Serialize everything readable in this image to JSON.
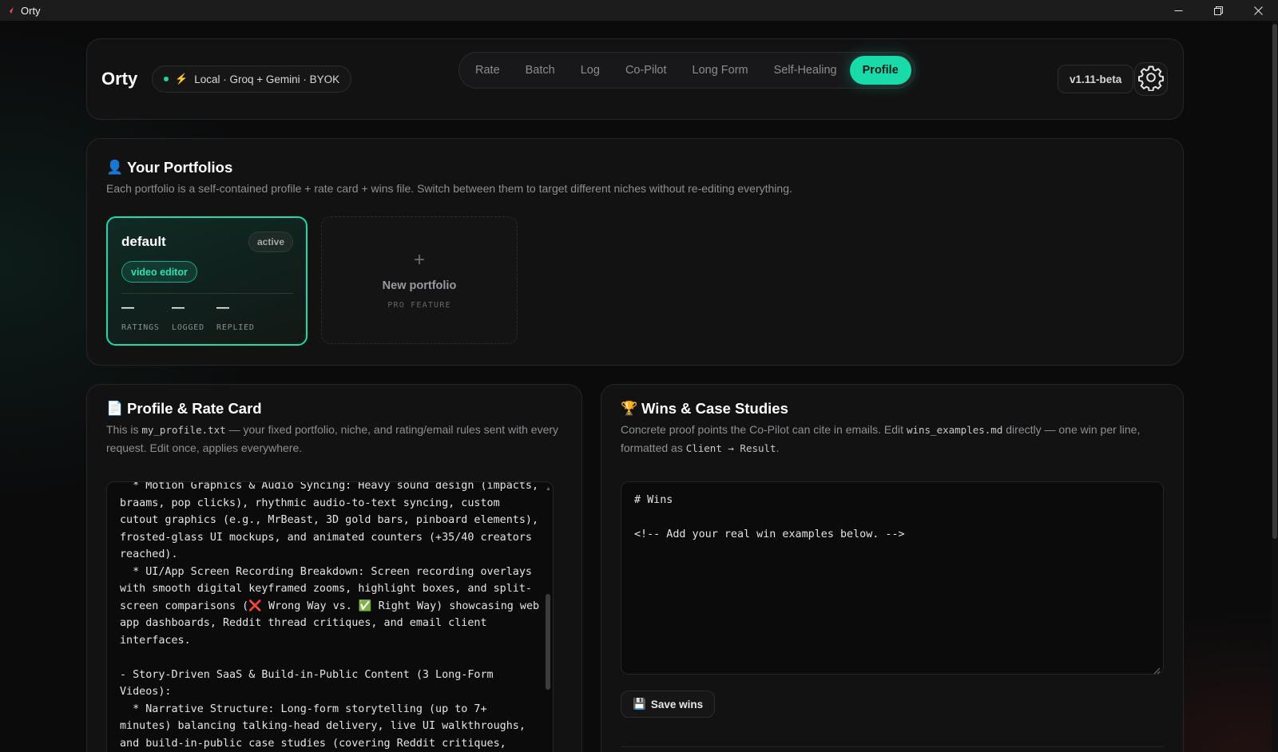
{
  "window": {
    "title": "Orty",
    "controls": [
      "minimize",
      "restore",
      "close"
    ]
  },
  "header": {
    "brand": "Orty",
    "mode": "Local · Groq + Gemini · BYOK",
    "tabs": [
      {
        "label": "Rate"
      },
      {
        "label": "Batch"
      },
      {
        "label": "Log"
      },
      {
        "label": "Co-Pilot"
      },
      {
        "label": "Long Form"
      },
      {
        "label": "Self-Healing"
      },
      {
        "label": "Profile",
        "active": true
      }
    ],
    "version": "v1.11-beta",
    "settings_icon": "gear-icon"
  },
  "portfolios": {
    "icon": "👤",
    "title": "Your Portfolios",
    "description": "Each portfolio is a self-contained profile + rate card + wins file. Switch between them to target different niches without re-editing everything.",
    "cards": [
      {
        "name": "default",
        "badge": "active",
        "tag": "video editor",
        "stats": [
          {
            "value": "—",
            "label": "RATINGS"
          },
          {
            "value": "—",
            "label": "LOGGED"
          },
          {
            "value": "—",
            "label": "REPLIED"
          }
        ]
      }
    ],
    "new_card": {
      "plus": "+",
      "label": "New portfolio",
      "sublabel": "PRO FEATURE"
    }
  },
  "profile": {
    "icon": "📄",
    "title": "Profile & Rate Card",
    "desc_pre": "This is ",
    "desc_code": "my_profile.txt",
    "desc_post": " — your fixed portfolio, niche, and rating/email rules sent with every request. Edit once, applies everywhere.",
    "content": "  * Motion Graphics & Audio Syncing: Heavy sound design (impacts, braams, pop clicks), rhythmic audio-to-text syncing, custom cutout graphics (e.g., MrBeast, 3D gold bars, pinboard elements), frosted-glass UI mockups, and animated counters (+35/40 creators reached).\n  * UI/App Screen Recording Breakdown: Screen recording overlays with smooth digital keyframed zooms, highlight boxes, and split-screen comparisons (❌ Wrong Way vs. ✅ Right Way) showcasing web app dashboards, Reddit thread critiques, and email client interfaces.\n\n- Story-Driven SaaS & Build-in-Public Content (3 Long-Form Videos):\n  * Narrative Structure: Long-form storytelling (up to 7+ minutes) balancing talking-head delivery, live UI walkthroughs, and build-in-public case studies (covering Reddit critiques,"
  },
  "wins": {
    "icon": "🏆",
    "title": "Wins & Case Studies",
    "desc_pre": "Concrete proof points the Co-Pilot can cite in emails. Edit ",
    "desc_code1": "wins_examples.md",
    "desc_mid": " directly — one win per line, formatted as ",
    "desc_code2": "Client → Result",
    "desc_post": ".",
    "content": "# Wins\n\n<!-- Add your real win examples below. -->",
    "save_icon": "💾",
    "save_label": "Save wins"
  },
  "colors": {
    "accent": "#19dbaa",
    "background": "#0b0b0c",
    "card": "#121213",
    "bolt": "#ff7a3c"
  }
}
